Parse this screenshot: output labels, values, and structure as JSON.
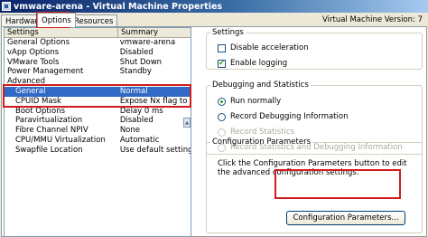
{
  "window": {
    "title": "vmware-arena - Virtual Machine Properties",
    "icon": "vm-icon",
    "version_label": "Virtual Machine Version: 7"
  },
  "tabs": [
    {
      "label": "Hardware",
      "active": false
    },
    {
      "label": "Options",
      "active": true
    },
    {
      "label": "Resources",
      "active": false
    }
  ],
  "settings_list": {
    "headers": {
      "setting": "Settings",
      "summary": "Summary"
    },
    "rows": [
      {
        "setting": "General Options",
        "summary": "vmware-arena"
      },
      {
        "setting": "vApp Options",
        "summary": "Disabled"
      },
      {
        "setting": "VMware Tools",
        "summary": "Shut Down"
      },
      {
        "setting": "Power Management",
        "summary": "Standby"
      },
      {
        "setting": "Advanced",
        "summary": "",
        "category": true
      },
      {
        "setting": "General",
        "summary": "Normal",
        "selected": true
      },
      {
        "setting": "CPUID Mask",
        "summary": "Expose Nx flag to"
      },
      {
        "setting": "Boot Options",
        "summary": "Delay 0 ms"
      },
      {
        "setting": "Paravirtualization",
        "summary": "Disabled"
      },
      {
        "setting": "Fibre Channel NPIV",
        "summary": "None"
      },
      {
        "setting": "CPU/MMU Virtualization",
        "summary": "Automatic"
      },
      {
        "setting": "Swapfile Location",
        "summary": "Use default settings"
      }
    ]
  },
  "settings_group": {
    "title": "Settings",
    "disable_acceleration": {
      "label": "Disable acceleration",
      "checked": false
    },
    "enable_logging": {
      "label": "Enable logging",
      "checked": true
    }
  },
  "debug_group": {
    "title": "Debugging and Statistics",
    "options": [
      {
        "label": "Run normally",
        "checked": true,
        "enabled": true
      },
      {
        "label": "Record Debugging Information",
        "checked": false,
        "enabled": true
      },
      {
        "label": "Record Statistics",
        "checked": false,
        "enabled": false
      },
      {
        "label": "Record Statistics and Debugging Information",
        "checked": false,
        "enabled": false
      }
    ]
  },
  "config_group": {
    "title": "Configuration Parameters",
    "description": "Click the Configuration Parameters button to edit the advanced configuration settings.",
    "button_label": "Configuration Parameters..."
  },
  "colors": {
    "highlight": "#d01c1c",
    "selection": "#316ac5",
    "titlebar": "#0a246a"
  }
}
